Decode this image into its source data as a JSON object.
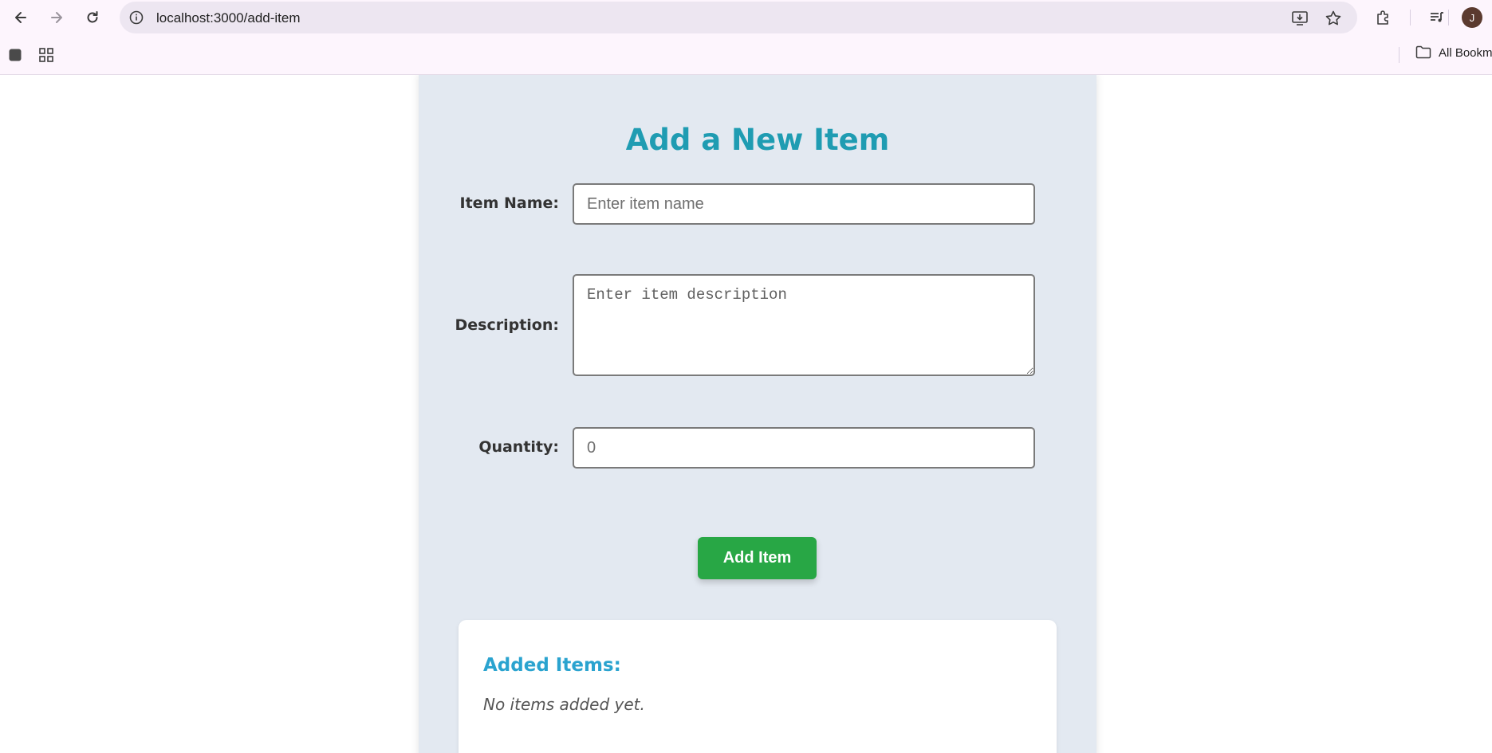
{
  "browser": {
    "url": "localhost:3000/add-item",
    "profile_initial": "J",
    "bookmarks_label": "All Bookm"
  },
  "form": {
    "title": "Add a New Item",
    "name_label": "Item Name:",
    "name_placeholder": "Enter item name",
    "description_label": "Description:",
    "description_placeholder": "Enter item description",
    "quantity_label": "Quantity:",
    "quantity_placeholder": "0",
    "submit_label": "Add Item"
  },
  "items": {
    "heading": "Added Items:",
    "empty_message": "No items added yet."
  },
  "colors": {
    "title": "#1f9cb2",
    "button": "#28a745",
    "items_heading": "#2aa3cf",
    "card_background": "#e3e9f1"
  }
}
